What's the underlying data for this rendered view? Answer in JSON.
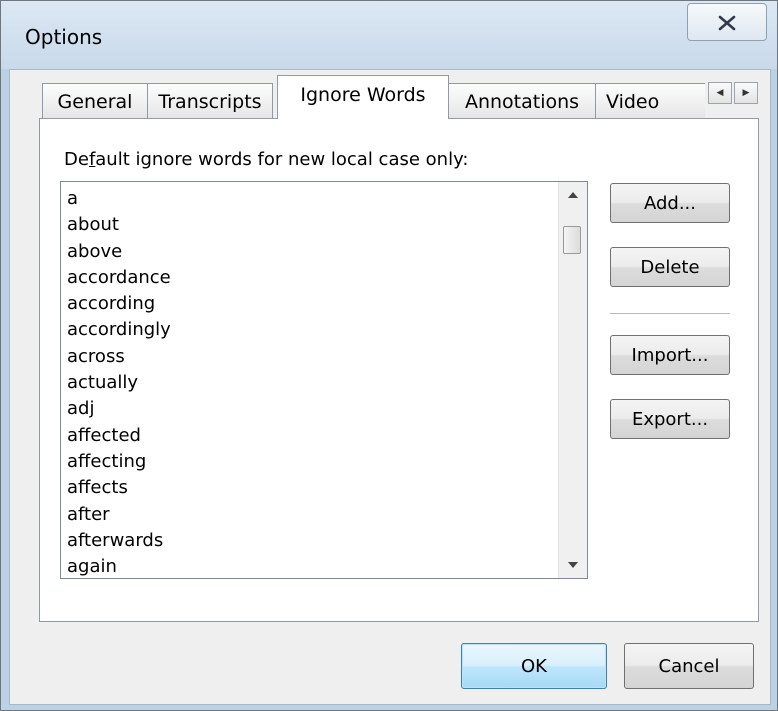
{
  "window": {
    "title": "Options",
    "close_label": "Close"
  },
  "tabs": [
    {
      "label": "General"
    },
    {
      "label": "Transcripts"
    },
    {
      "label": "Ignore Words"
    },
    {
      "label": "Annotations"
    },
    {
      "label": "Video"
    }
  ],
  "active_tab": "Ignore Words",
  "ignore_words": {
    "caption_prefix": "De",
    "caption_mnemonic": "f",
    "caption_suffix": "ault ignore words for new local case only:",
    "words": [
      "a",
      "about",
      "above",
      "accordance",
      "according",
      "accordingly",
      "across",
      "actually",
      "adj",
      "affected",
      "affecting",
      "affects",
      "after",
      "afterwards",
      "again"
    ],
    "scroll_position": 0.05
  },
  "buttons": {
    "add": "Add...",
    "delete": "Delete",
    "import": "Import...",
    "export": "Export...",
    "ok": "OK",
    "cancel": "Cancel"
  },
  "colors": {
    "titlebar": "#c8d9ea",
    "default_button_border": "#3c7fb1",
    "client_bg": "#efefef"
  }
}
